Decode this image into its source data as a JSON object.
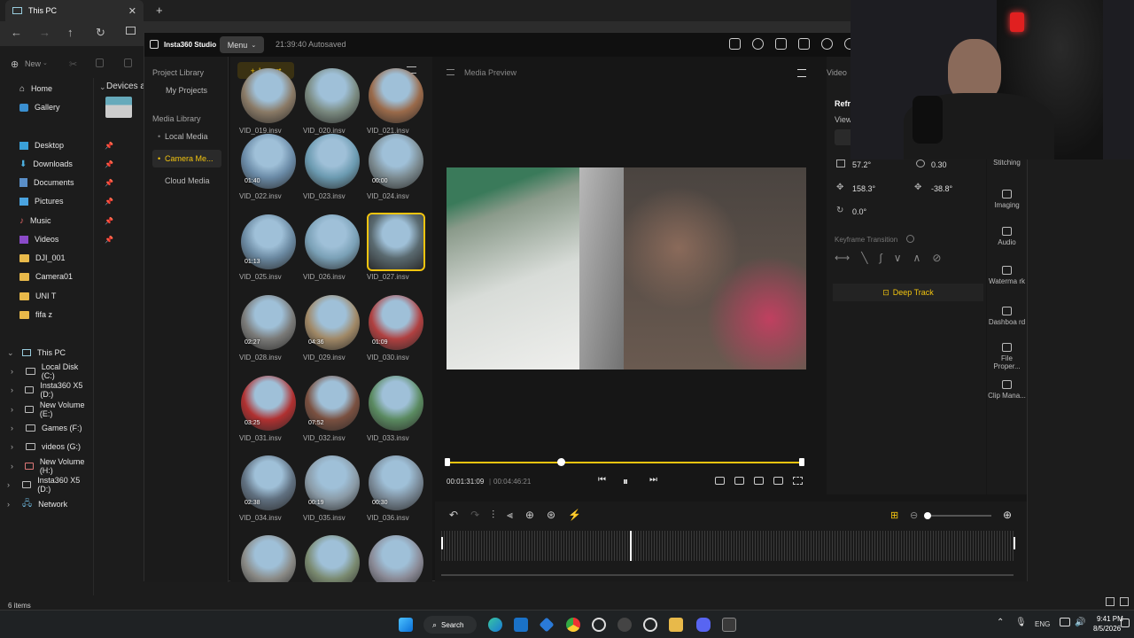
{
  "explorer": {
    "tab_title": "This PC",
    "new_label": "New",
    "devices_header": "Devices a",
    "quick": [
      {
        "label": "Home",
        "icon": "home-icon"
      },
      {
        "label": "Gallery",
        "icon": "gallery-icon"
      },
      {
        "label": "Desktop",
        "icon": "desktop-icon"
      },
      {
        "label": "Downloads",
        "icon": "downloads-icon"
      },
      {
        "label": "Documents",
        "icon": "documents-icon"
      },
      {
        "label": "Pictures",
        "icon": "pictures-icon"
      },
      {
        "label": "Music",
        "icon": "music-icon"
      },
      {
        "label": "Videos",
        "icon": "videos-icon"
      },
      {
        "label": "DJI_001",
        "icon": "folder-icon"
      },
      {
        "label": "Camera01",
        "icon": "folder-icon"
      },
      {
        "label": "UNI T",
        "icon": "folder-icon"
      },
      {
        "label": "fifa z",
        "icon": "folder-icon"
      }
    ],
    "this_pc": "This PC",
    "drives": [
      "Local Disk (C:)",
      "Insta360 X5 (D:)",
      "New Volume (E:)",
      "Games (F:)",
      "videos (G:)",
      "New Volume (H:)"
    ],
    "insta_drive": "Insta360 X5 (D:)",
    "network": "Network",
    "status": "6 items"
  },
  "insta": {
    "app_name": "Insta360 Studio",
    "menu": "Menu",
    "autosave": "21:39:40 Autosaved",
    "project_library": "Project Library",
    "my_projects": "My Projects",
    "media_library": "Media Library",
    "local_media": "Local Media",
    "camera_media": "Camera Me...",
    "cloud_media": "Cloud Media",
    "import": "Import",
    "thumbs": [
      {
        "name": "VID_019.insv",
        "dur": ""
      },
      {
        "name": "VID_020.insv",
        "dur": ""
      },
      {
        "name": "VID_021.insv",
        "dur": ""
      },
      {
        "name": "VID_022.insv",
        "dur": "01:40"
      },
      {
        "name": "VID_023.insv",
        "dur": ""
      },
      {
        "name": "VID_024.insv",
        "dur": "00:00"
      },
      {
        "name": "VID_025.insv",
        "dur": "01:13"
      },
      {
        "name": "VID_026.insv",
        "dur": ""
      },
      {
        "name": "VID_027.insv",
        "dur": ""
      },
      {
        "name": "VID_028.insv",
        "dur": "02:27"
      },
      {
        "name": "VID_029.insv",
        "dur": "04:36"
      },
      {
        "name": "VID_030.insv",
        "dur": "01:09"
      },
      {
        "name": "VID_031.insv",
        "dur": "03:25"
      },
      {
        "name": "VID_032.insv",
        "dur": "07:52"
      },
      {
        "name": "VID_033.insv",
        "dur": ""
      },
      {
        "name": "VID_034.insv",
        "dur": "02:38"
      },
      {
        "name": "VID_035.insv",
        "dur": "00:19"
      },
      {
        "name": "VID_036.insv",
        "dur": "00:30"
      },
      {
        "name": "",
        "dur": ""
      },
      {
        "name": "",
        "dur": ""
      },
      {
        "name": "",
        "dur": ""
      }
    ],
    "thumb_colors": [
      "#8a7a66",
      "#7a8a80",
      "#9a6a4a",
      "#6a8aa6",
      "#6b9ab0",
      "#7b8a90",
      "#6a88a0",
      "#7aa0b6",
      "#5a6a70",
      "#7a7a78",
      "#a08866",
      "#b04040",
      "#b03030",
      "#7a5040",
      "#5a8a60",
      "#607080",
      "#8a9aa6",
      "#7a8a98",
      "#8a8a86",
      "#7a8a70",
      "#8a8a96"
    ],
    "preview_title": "Media Preview",
    "timecode_current": "00:01:31:09",
    "timecode_total": "00:04:46:21",
    "seek_progress": 0.32,
    "panel_tab": "Video",
    "reframe_label": "Refra",
    "view_label": "View",
    "fov": "57.2°",
    "distortion": "0.30",
    "pan": "158.3°",
    "tilt": "-38.8°",
    "roll": "0.0°",
    "keyframe_transition": "Keyframe Transition",
    "deep_track": "Deep Track",
    "tools": [
      "Stitching",
      "Imaging",
      "Audio",
      "Waterma rk",
      "Dashboa rd",
      "File Proper...",
      "Clip Mana..."
    ],
    "timeline_playhead": 0.33,
    "accent": "#f2c40f"
  },
  "taskbar": {
    "search": "Search",
    "lang": "ENG",
    "time": "9:41 PM",
    "date": "8/5/2026"
  }
}
